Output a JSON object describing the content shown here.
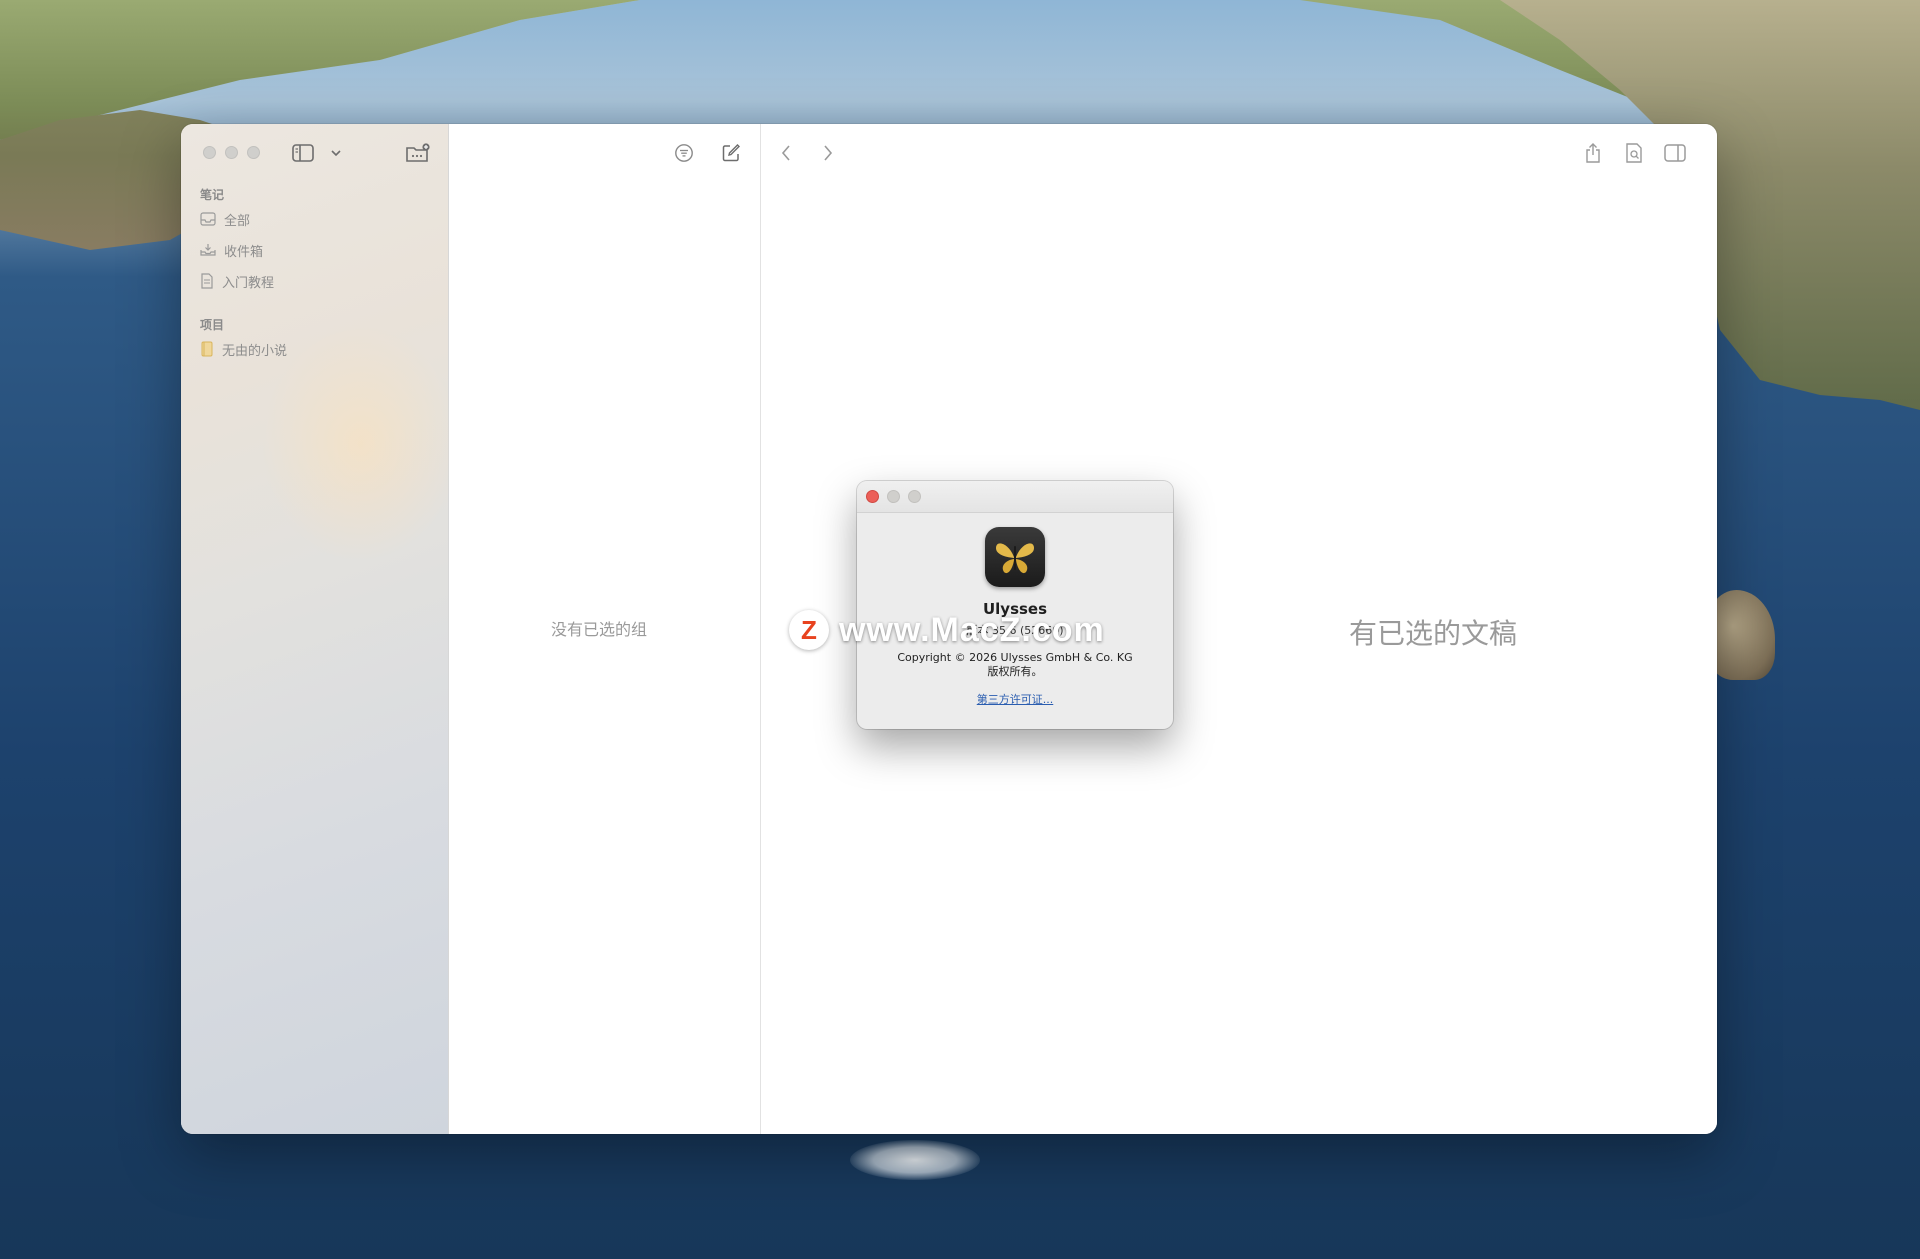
{
  "sidebar": {
    "section_notes": "笔记",
    "items_notes": [
      {
        "label": "全部",
        "icon": "tray-icon"
      },
      {
        "label": "收件箱",
        "icon": "inbox-icon"
      },
      {
        "label": "入门教程",
        "icon": "document-icon"
      }
    ],
    "section_projects": "项目",
    "items_projects": [
      {
        "label": "无由的小说",
        "icon": "book-icon"
      }
    ]
  },
  "list_pane": {
    "empty_text": "没有已选的组"
  },
  "editor_pane": {
    "empty_text": "有已选的文稿"
  },
  "about_dialog": {
    "app_name": "Ulysses",
    "version_text": "版本 35 6 (52660)",
    "copyright_line1": "Copyright © 2026 Ulysses GmbH & Co. KG",
    "copyright_line2": "版权所有。",
    "license_link": "第三方许可证..."
  },
  "watermark": {
    "badge": "Z",
    "text": "www.MacZ.com"
  },
  "colors": {
    "accent_link": "#2a5db0",
    "close_red": "#ec5f58",
    "icon_gold": "#e3b94a",
    "watermark_red": "#e8431f"
  }
}
